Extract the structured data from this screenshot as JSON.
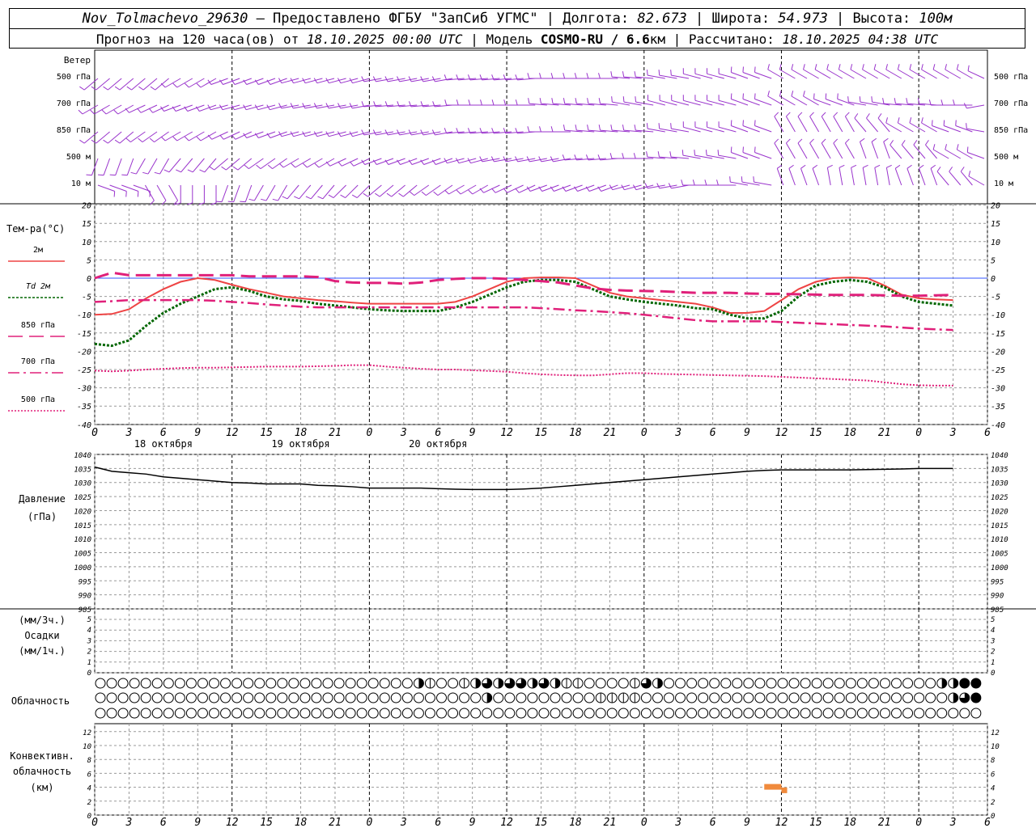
{
  "header": {
    "station": "Nov_Tolmachevo_29630",
    "provider": " – Предоставлено ФГБУ \"ЗапСиб УГМС\" | Долгота: ",
    "lon": "82.673",
    "lat_label": " | Широта: ",
    "lat": "54.973",
    "alt_label": " | Высота: ",
    "alt": "100м",
    "forecast_label": "Прогноз на 120 часа(ов) от ",
    "run_time": "18.10.2025 00:00 UTC",
    "model_label": "  | Модель ",
    "model": "COSMO-RU / 6.6",
    "model_unit": "км",
    "calc_label": " | Рассчитано: ",
    "calc_time": "18.10.2025 04:38 UTC"
  },
  "colors": {
    "wind": "#9933cc",
    "t2m": "#ee4444",
    "td2m": "#006600",
    "t850": "#e0207a",
    "t700": "#e0207a",
    "t500": "#e0207a",
    "pressure": "#000000",
    "zero_line": "#3355ff",
    "grid": "#999999",
    "conv_cloud": "#f08a3c"
  },
  "x_axis": {
    "hours": [
      "0",
      "3",
      "6",
      "9",
      "12",
      "15",
      "18",
      "21",
      "0",
      "3",
      "6",
      "9",
      "12",
      "15",
      "18",
      "21",
      "0",
      "3",
      "6",
      "9",
      "12",
      "15",
      "18",
      "21",
      "0",
      "3",
      "6"
    ],
    "dates": [
      {
        "label": "18 октября",
        "hour": 12
      },
      {
        "label": "19 октября",
        "hour": 36
      },
      {
        "label": "20 октября",
        "hour": 60
      }
    ]
  },
  "wind": {
    "title": "Ветер",
    "levels": [
      "500 гПа",
      "700 гПа",
      "850 гПа",
      "500 м",
      "10 м"
    ],
    "dirs": [
      [
        230,
        230,
        240,
        250,
        250,
        255,
        255,
        260,
        260,
        265,
        265,
        270,
        270,
        275,
        280,
        285,
        290,
        300,
        300,
        300,
        300,
        300,
        295,
        295
      ],
      [
        240,
        245,
        250,
        255,
        255,
        260,
        260,
        265,
        265,
        270,
        270,
        275,
        275,
        280,
        285,
        285,
        290,
        300,
        290,
        280,
        275,
        270,
        260,
        260
      ],
      [
        230,
        235,
        240,
        245,
        250,
        255,
        255,
        260,
        260,
        265,
        265,
        270,
        275,
        275,
        280,
        285,
        290,
        330,
        330,
        320,
        300,
        290,
        280,
        270
      ],
      [
        200,
        210,
        220,
        230,
        235,
        240,
        245,
        250,
        250,
        255,
        260,
        260,
        265,
        270,
        275,
        280,
        290,
        330,
        330,
        340,
        320,
        300,
        290,
        280
      ],
      [
        110,
        150,
        180,
        200,
        210,
        220,
        225,
        230,
        235,
        240,
        245,
        250,
        250,
        255,
        260,
        270,
        280,
        340,
        350,
        350,
        340,
        320,
        300,
        290
      ]
    ],
    "tick_labels": [
      "Ветер",
      "500 гПа",
      "700 гПа",
      "850 гПа",
      "500 м",
      "10 м"
    ]
  },
  "chart_data": [
    {
      "type": "line",
      "ylabel": "Тем-ра(°С)",
      "ylim": [
        -40,
        20
      ],
      "yticks": [
        20,
        15,
        10,
        5,
        0,
        -5,
        -10,
        -15,
        -20,
        -25,
        -30,
        -35,
        -40
      ],
      "x_hours": [
        0,
        3,
        6,
        9,
        12,
        15,
        18,
        21,
        24,
        27,
        30,
        33,
        36,
        39,
        42,
        45,
        48,
        51,
        54,
        57,
        60,
        63,
        66,
        69,
        72,
        75,
        78,
        81,
        84,
        87,
        90,
        93,
        96,
        99,
        102,
        105,
        108,
        111,
        114,
        117,
        120,
        123,
        126,
        129,
        132,
        135,
        138,
        141,
        144,
        147,
        150
      ],
      "series": [
        {
          "name": "2м",
          "style": "solid",
          "values": [
            -10,
            -9.8,
            -8.5,
            -5.5,
            -3,
            -1,
            0,
            -0.5,
            -1.8,
            -3,
            -4,
            -5,
            -5.5,
            -6,
            -6.3,
            -6.7,
            -7,
            -7,
            -7,
            -7,
            -7,
            -6.5,
            -5,
            -3,
            -1,
            0,
            0.2,
            0.2,
            0,
            -2,
            -4,
            -5,
            -5.5,
            -6,
            -6.5,
            -7,
            -8,
            -9.5,
            -9.5,
            -9,
            -6,
            -3,
            -1,
            0,
            0.2,
            0,
            -2,
            -4.5,
            -5.5,
            -5.8,
            -6
          ]
        },
        {
          "name": "Td 2м",
          "style": "dotted",
          "values": [
            -18,
            -18.5,
            -17,
            -13,
            -9.5,
            -7,
            -5,
            -3,
            -2.5,
            -3.5,
            -5,
            -5.8,
            -6.2,
            -7,
            -7.5,
            -8,
            -8.5,
            -8.8,
            -9,
            -9,
            -9,
            -8,
            -6.5,
            -4.5,
            -2.5,
            -1,
            -0.5,
            -0.5,
            -1,
            -3,
            -5,
            -5.8,
            -6.5,
            -7,
            -7.5,
            -8.2,
            -8.5,
            -10,
            -11,
            -11,
            -9,
            -5,
            -2,
            -1,
            -0.5,
            -1,
            -2.5,
            -5,
            -6.5,
            -7,
            -7.5
          ]
        },
        {
          "name": "850 гПа",
          "style": "longdash",
          "values": [
            0,
            1.5,
            0.8,
            0.8,
            0.8,
            0.8,
            0.8,
            0.8,
            0.8,
            0.5,
            0.5,
            0.5,
            0.5,
            0.3,
            -0.8,
            -1.2,
            -1.3,
            -1.3,
            -1.5,
            -1.2,
            -0.5,
            -0.2,
            0,
            0,
            -0.2,
            -0.5,
            -0.8,
            -1.2,
            -2,
            -2.8,
            -3.2,
            -3.4,
            -3.5,
            -3.6,
            -3.8,
            -4,
            -4,
            -4,
            -4.2,
            -4.3,
            -4.3,
            -4.4,
            -4.5,
            -4.6,
            -4.6,
            -4.6,
            -4.7,
            -4.8,
            -4.8,
            -4.7,
            -4.6
          ]
        },
        {
          "name": "700 гПа",
          "style": "dashdot",
          "values": [
            -6.5,
            -6.3,
            -6,
            -6,
            -6,
            -6,
            -6,
            -6.2,
            -6.5,
            -6.8,
            -7.2,
            -7.5,
            -7.8,
            -8,
            -8,
            -8,
            -8,
            -8,
            -8,
            -8,
            -8,
            -8,
            -8,
            -8,
            -8,
            -8,
            -8.2,
            -8.5,
            -8.8,
            -9,
            -9.3,
            -9.6,
            -10,
            -10.5,
            -11,
            -11.5,
            -11.8,
            -11.8,
            -11.8,
            -11.8,
            -12,
            -12.2,
            -12.4,
            -12.6,
            -12.8,
            -13,
            -13.2,
            -13.5,
            -13.8,
            -14,
            -14.2
          ]
        },
        {
          "name": "500 гПа",
          "style": "fine",
          "values": [
            -25.3,
            -25.5,
            -25.3,
            -25,
            -24.8,
            -24.6,
            -24.5,
            -24.5,
            -24.4,
            -24.3,
            -24.2,
            -24.2,
            -24.2,
            -24.1,
            -24,
            -23.8,
            -23.8,
            -24.2,
            -24.5,
            -24.8,
            -25,
            -25,
            -25.2,
            -25.4,
            -25.6,
            -26,
            -26.3,
            -26.5,
            -26.6,
            -26.6,
            -26.3,
            -26,
            -26,
            -26.2,
            -26.3,
            -26.4,
            -26.5,
            -26.6,
            -26.7,
            -26.8,
            -27,
            -27.2,
            -27.4,
            -27.6,
            -27.8,
            -28,
            -28.5,
            -29,
            -29.3,
            -29.4,
            -29.4
          ]
        }
      ]
    },
    {
      "type": "line",
      "ylabel": "Давление",
      "yunit": "(гПа)",
      "ylim": [
        985,
        1040
      ],
      "yticks": [
        1040,
        1035,
        1030,
        1025,
        1020,
        1015,
        1010,
        1005,
        1000,
        995,
        990,
        985
      ],
      "x_hours": [
        0,
        3,
        6,
        9,
        12,
        15,
        18,
        21,
        24,
        27,
        30,
        33,
        36,
        39,
        42,
        45,
        48,
        51,
        54,
        57,
        60,
        63,
        66,
        69,
        72,
        75,
        78,
        81,
        84,
        87,
        90,
        93,
        96,
        99,
        102,
        105,
        108,
        111,
        114,
        117,
        120,
        123,
        126,
        129,
        132,
        135,
        138,
        141,
        144,
        147,
        150
      ],
      "series": [
        {
          "name": "",
          "values": [
            1035.5,
            1034,
            1033.5,
            1033,
            1032,
            1031.5,
            1031,
            1030.5,
            1030,
            1029.8,
            1029.5,
            1029.5,
            1029.5,
            1029,
            1028.8,
            1028.5,
            1028,
            1028,
            1028,
            1028,
            1027.8,
            1027.6,
            1027.5,
            1027.5,
            1027.5,
            1027.7,
            1028,
            1028.5,
            1029,
            1029.5,
            1030,
            1030.5,
            1031,
            1031.5,
            1032,
            1032.5,
            1033,
            1033.5,
            1034,
            1034.3,
            1034.5,
            1034.5,
            1034.5,
            1034.5,
            1034.5,
            1034.6,
            1034.7,
            1034.8,
            1035,
            1035,
            1035
          ]
        }
      ]
    },
    {
      "type": "bar",
      "ylabel": "(мм/3ч.)",
      "ylabel2": "Осадки",
      "ylabel3": "(мм/1ч.)",
      "ylim": [
        0,
        5
      ],
      "yticks": [
        5,
        4,
        3,
        2,
        1,
        0
      ],
      "values": []
    },
    {
      "type": "table",
      "ylabel": "Облачность",
      "rows": [
        [
          0,
          0,
          0,
          0,
          0,
          0,
          0,
          0,
          0,
          0,
          0,
          0,
          0,
          0,
          0,
          0,
          0,
          0,
          0,
          0,
          0,
          0,
          0,
          0,
          0,
          0,
          0,
          0,
          0,
          0,
          0,
          0,
          0,
          0,
          0,
          0,
          0,
          0,
          0,
          0,
          0,
          0,
          0,
          0,
          0,
          0,
          0,
          0,
          0,
          0,
          0,
          0,
          0,
          0,
          0,
          0,
          0,
          0,
          0,
          0,
          0,
          0,
          0,
          0,
          0,
          0,
          0,
          0,
          0,
          0,
          0,
          0,
          0,
          0,
          0,
          0,
          0,
          0,
          0,
          0
        ],
        [
          0,
          0,
          0,
          0,
          0,
          0,
          0,
          0,
          0,
          0,
          0,
          0,
          0,
          0,
          0,
          0,
          0,
          0,
          0,
          0,
          0,
          0,
          0,
          0,
          0,
          0,
          0,
          0,
          0,
          0,
          0,
          0,
          0,
          0,
          0,
          0,
          0,
          0,
          0,
          0,
          0,
          0,
          0,
          0,
          0,
          0,
          0,
          0,
          0,
          0,
          0,
          0,
          0,
          0,
          0,
          0,
          0,
          0,
          0,
          0,
          0,
          0,
          0,
          0,
          0,
          0,
          0,
          0,
          0,
          0,
          0,
          0,
          0,
          0,
          0,
          0,
          0,
          0,
          0,
          0
        ],
        [
          0,
          0,
          0,
          0,
          0,
          0,
          0,
          0,
          0,
          0,
          0,
          0,
          0,
          0,
          0,
          0,
          0,
          0,
          0,
          0,
          0,
          0,
          0,
          0,
          0,
          0,
          0,
          0,
          0,
          0,
          0,
          0,
          0,
          0,
          0,
          0,
          0,
          0,
          0,
          0,
          0,
          0,
          0,
          0,
          0,
          0,
          0,
          0,
          0,
          0,
          0,
          0,
          0,
          0,
          0,
          0,
          0,
          0,
          0,
          0,
          0,
          0,
          0,
          0,
          0,
          0,
          0,
          0,
          0,
          0,
          0,
          0,
          0,
          0,
          0,
          0,
          0,
          0,
          0,
          0
        ]
      ],
      "high_marks": {
        "start": 28,
        "pattern": [
          2,
          1,
          0,
          0,
          1,
          2,
          3,
          2,
          3,
          3,
          2,
          3,
          2,
          1,
          1,
          0,
          0,
          0,
          0,
          1,
          3,
          2,
          0,
          0,
          0,
          0,
          0,
          0,
          0,
          0,
          0,
          0,
          0,
          0,
          0,
          0,
          0,
          0,
          0,
          0,
          0,
          0,
          0,
          0,
          0,
          0,
          2,
          2,
          4,
          4,
          4,
          1,
          4,
          3,
          0,
          2,
          3,
          4,
          2,
          3,
          2,
          0,
          0,
          0,
          0,
          0
        ]
      },
      "mid_marks": {
        "start": 34,
        "pattern": [
          2,
          0,
          0,
          0,
          0,
          0,
          0,
          0,
          0,
          0,
          1,
          1,
          1,
          1,
          0,
          0,
          0,
          0,
          0,
          0,
          0,
          0,
          0,
          0,
          0,
          0,
          0,
          0,
          0,
          0,
          0,
          0,
          0,
          0,
          0,
          0,
          0,
          0,
          0,
          0,
          0,
          2,
          3,
          4,
          2,
          2,
          3,
          0,
          3,
          1,
          2,
          4,
          3,
          4,
          4,
          4,
          4,
          4,
          4,
          4,
          4,
          4
        ]
      }
    },
    {
      "type": "bar",
      "ylabel": "Конвективн.",
      "ylabel2": "облачность",
      "ylabel3": "(км)",
      "ylim": [
        0,
        13
      ],
      "yticks": [
        12,
        10,
        8,
        6,
        4,
        2,
        0
      ],
      "segments": [
        {
          "h0": 117,
          "h1": 120,
          "value": 4
        },
        {
          "h0": 120,
          "h1": 121,
          "value": 3.5
        }
      ]
    }
  ]
}
